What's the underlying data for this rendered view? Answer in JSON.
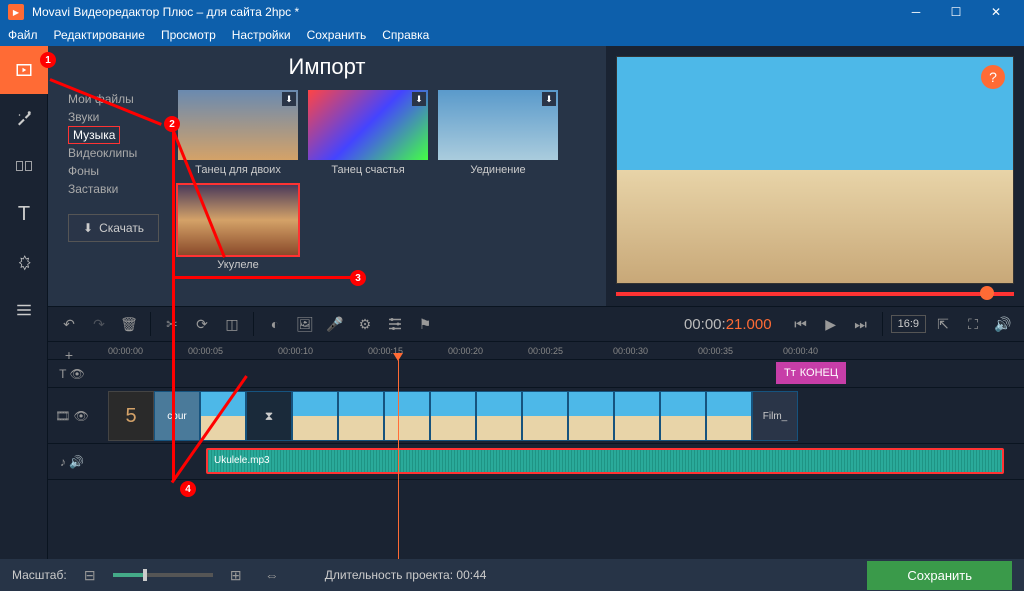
{
  "titlebar": {
    "title": "Movavi Видеоредактор Плюс – для сайта 2hpc *"
  },
  "menu": {
    "file": "Файл",
    "edit": "Редактирование",
    "view": "Просмотр",
    "settings": "Настройки",
    "save": "Сохранить",
    "help": "Справка"
  },
  "import": {
    "title": "Импорт",
    "nav": {
      "myfiles": "Мои файлы",
      "sounds": "Звуки",
      "music": "Музыка",
      "videoclips": "Видеоклипы",
      "backgrounds": "Фоны",
      "intros": "Заставки"
    },
    "download": "Скачать",
    "items": [
      {
        "label": "Танец для двоих"
      },
      {
        "label": "Танец счастья"
      },
      {
        "label": "Уединение"
      },
      {
        "label": "Укулеле"
      }
    ]
  },
  "playback": {
    "time_dim": "00:00:",
    "time_hi": "21.000",
    "aspect": "16:9"
  },
  "ruler": [
    "00:00:00",
    "00:00:05",
    "00:00:10",
    "00:00:15",
    "00:00:20",
    "00:00:25",
    "00:00:30",
    "00:00:35",
    "00:00:40"
  ],
  "timeline": {
    "end_label": "КОНЕЦ",
    "film_count": "5",
    "cour": "cour",
    "film_end": "Film_",
    "audio_name": "Ukulele.mp3"
  },
  "footer": {
    "scale": "Масштаб:",
    "duration": "Длительность проекта: 00:44",
    "save": "Сохранить"
  },
  "annotations": {
    "a1": "1",
    "a2": "2",
    "a3": "3",
    "a4": "4"
  }
}
